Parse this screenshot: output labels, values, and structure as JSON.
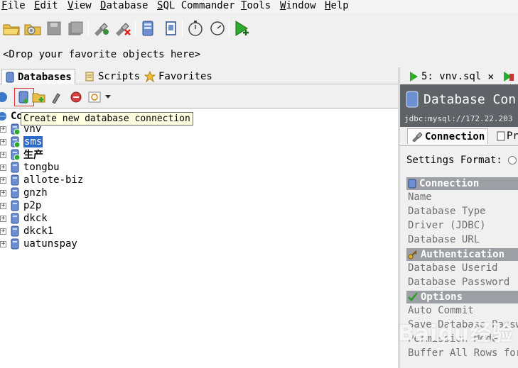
{
  "menubar": {
    "items": [
      {
        "mnemonic": "F",
        "rest": "ile"
      },
      {
        "mnemonic": "E",
        "rest": "dit"
      },
      {
        "mnemonic": "V",
        "rest": "iew"
      },
      {
        "mnemonic": "D",
        "rest": "atabase"
      },
      {
        "mnemonic": "S",
        "rest": "QL Commander"
      },
      {
        "mnemonic": "T",
        "rest": "ools"
      },
      {
        "mnemonic": "W",
        "rest": "indow"
      },
      {
        "mnemonic": "H",
        "rest": "elp"
      }
    ]
  },
  "favorites_bar": {
    "placeholder": "<Drop your favorite objects here>"
  },
  "left_tabs": [
    {
      "label": "Databases",
      "icon": "database-icon",
      "active": true
    },
    {
      "label": "Scripts",
      "icon": "scripts-icon",
      "active": false
    },
    {
      "label": "Favorites",
      "icon": "star-icon",
      "active": false
    }
  ],
  "tooltip": "Create new database connection",
  "tree": {
    "root_label": "Co",
    "items": [
      {
        "label": "vnv",
        "connected": true,
        "selected": false,
        "bold": false
      },
      {
        "label": "sms",
        "connected": true,
        "selected": true,
        "bold": false
      },
      {
        "label": "生产",
        "connected": true,
        "selected": false,
        "bold": true
      },
      {
        "label": "tongbu",
        "connected": false,
        "selected": false,
        "bold": false
      },
      {
        "label": "allote-biz",
        "connected": false,
        "selected": false,
        "bold": false
      },
      {
        "label": "gnzh",
        "connected": false,
        "selected": false,
        "bold": false
      },
      {
        "label": "p2p",
        "connected": false,
        "selected": false,
        "bold": false
      },
      {
        "label": "dkck",
        "connected": false,
        "selected": false,
        "bold": false
      },
      {
        "label": "dkck1",
        "connected": false,
        "selected": false,
        "bold": false
      },
      {
        "label": "uatunspay",
        "connected": false,
        "selected": false,
        "bold": false
      }
    ]
  },
  "right_panel": {
    "editor_tab": {
      "label": "5: vnv.sql",
      "close": "×"
    },
    "header_title": "Database Con",
    "header_url": "jdbc:mysql://172.22.203",
    "subtabs": [
      {
        "label": "Connection",
        "active": true
      },
      {
        "label": "Pr",
        "active": false
      }
    ],
    "settings_format_label": "Settings Format:",
    "sections": [
      {
        "title": "Connection",
        "icon": "database-icon",
        "fields": [
          "Name",
          "Database Type",
          "Driver (JDBC)",
          "Database URL"
        ]
      },
      {
        "title": "Authentication",
        "icon": "key-icon",
        "fields": [
          "Database Userid",
          "Database Password"
        ]
      },
      {
        "title": "Options",
        "icon": "checkmark-icon",
        "fields": [
          "Auto Commit",
          "Save Database Passwo",
          "Permission Mode",
          "Buffer All Rows for"
        ]
      }
    ],
    "watermark": "Baidu经验"
  },
  "colors": {
    "selection": "#2a6ac8",
    "header_bg": "#5f6266",
    "section_bg": "#9c9fa3",
    "tooltip_bg": "#ffffe1",
    "run_green": "#2eaa2e"
  }
}
